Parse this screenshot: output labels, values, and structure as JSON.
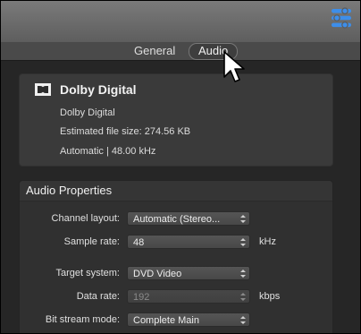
{
  "tabs": [
    {
      "label": "General"
    },
    {
      "label": "Audio"
    }
  ],
  "summary": {
    "title": "Dolby Digital",
    "format": "Dolby Digital",
    "file_size": "Estimated file size: 274.56 KB",
    "rate_info": "Automatic | 48.00 kHz"
  },
  "audio_properties": {
    "title": "Audio Properties",
    "channel_layout": {
      "label": "Channel layout:",
      "value": "Automatic (Stereo..."
    },
    "sample_rate": {
      "label": "Sample rate:",
      "value": "48",
      "unit": "kHz"
    },
    "target_system": {
      "label": "Target system:",
      "value": "DVD Video"
    },
    "data_rate": {
      "label": "Data rate:",
      "value": "192",
      "unit": "kbps"
    },
    "bit_stream_mode": {
      "label": "Bit stream mode:",
      "value": "Complete Main"
    }
  },
  "icons": {
    "toolbar": "inspector-sliders-icon",
    "summary": "dolby-digital-icon",
    "cursor": "mouse-pointer-icon"
  },
  "colors": {
    "accent": "#3d8eea"
  }
}
